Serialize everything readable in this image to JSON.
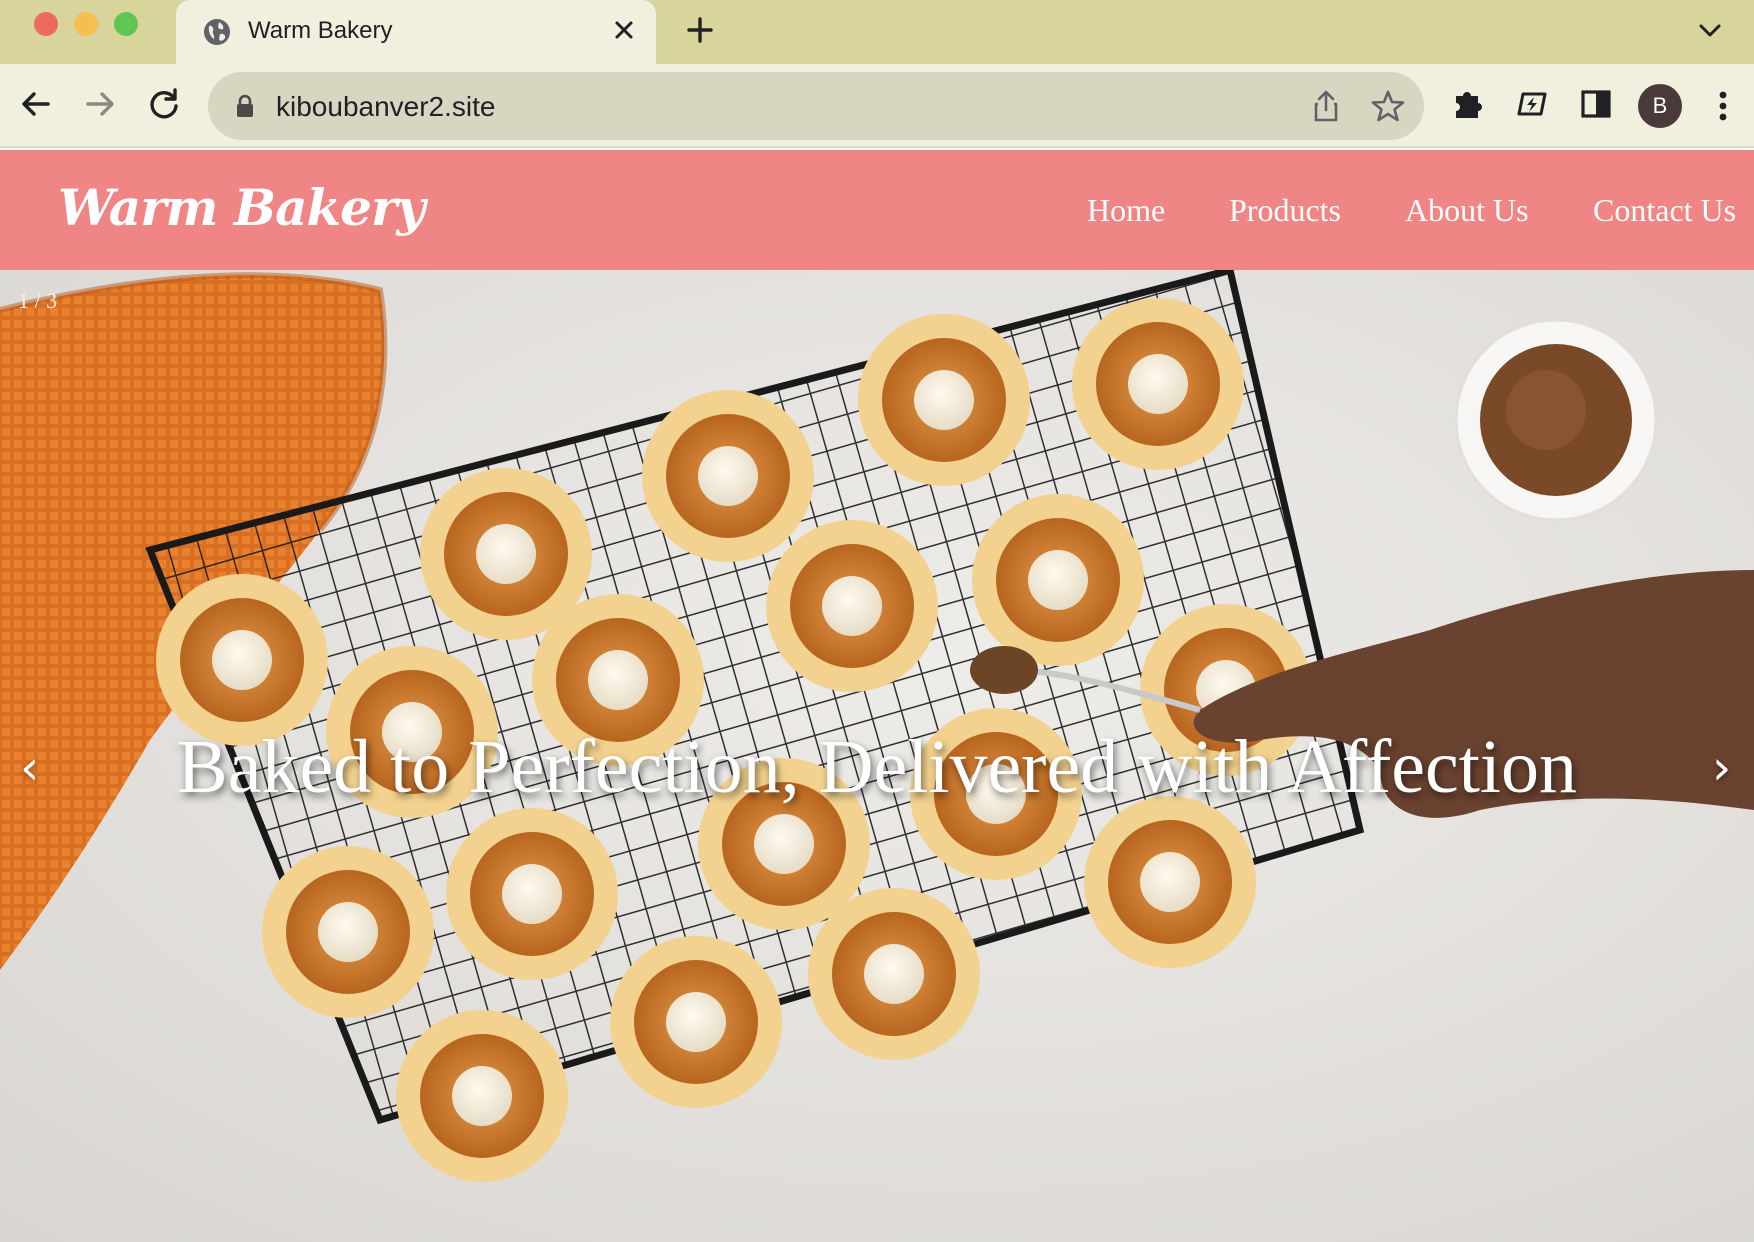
{
  "browser": {
    "tab_title": "Warm Bakery",
    "address": "kiboubanver2.site",
    "profile_initial": "B",
    "icons": {
      "tab": "globe-icon",
      "close": "close-icon",
      "new_tab": "plus-icon",
      "tab_list": "chevron-down-icon",
      "back": "back-arrow-icon",
      "forward": "forward-arrow-icon",
      "reload": "reload-icon",
      "secure": "lock-icon",
      "share": "share-icon",
      "bookmark": "star-icon",
      "extensions": "puzzle-icon",
      "extension": "bolt-icon",
      "side_panel": "side-panel-icon",
      "menu": "kebab-menu-icon"
    }
  },
  "site": {
    "logo": "Warm Bakery",
    "nav": [
      "Home",
      "Products",
      "About Us",
      "Contact Us"
    ],
    "colors": {
      "header_bg": "#ef8584",
      "header_text": "#ffffff"
    }
  },
  "hero": {
    "counter": "1 / 3",
    "headline": "Baked to Perfection, Delivered with Affection",
    "prev_arrow": "‹",
    "next_arrow": "›"
  }
}
